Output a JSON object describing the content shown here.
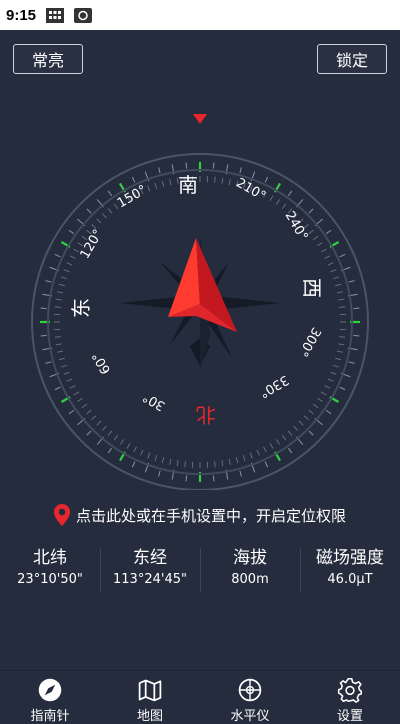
{
  "status_bar": {
    "time": "9:15"
  },
  "header": {
    "left_button": "常亮",
    "right_button": "锁定"
  },
  "compass": {
    "cardinals": {
      "south": "南",
      "west": "西",
      "north": "北",
      "east": "东"
    },
    "degree_labels": [
      "210°",
      "240°",
      "300°",
      "330°",
      "30°",
      "60°",
      "120°",
      "150°"
    ],
    "colors": {
      "needle": "#e8262d",
      "north_label": "#e8262d",
      "tick_accent": "#2fd23c",
      "background": "#252c3d"
    }
  },
  "location": {
    "icon": "map-pin-icon",
    "text": "点击此处或在手机设置中，开启定位权限"
  },
  "stats": [
    {
      "label": "北纬",
      "value": "23°10'50\""
    },
    {
      "label": "东经",
      "value": "113°24'45\""
    },
    {
      "label": "海拔",
      "value": "800m"
    },
    {
      "label": "磁场强度",
      "value": "46.0μT"
    }
  ],
  "bottom_nav": [
    {
      "label": "指南针",
      "icon": "compass-icon"
    },
    {
      "label": "地图",
      "icon": "map-icon"
    },
    {
      "label": "水平仪",
      "icon": "level-icon"
    },
    {
      "label": "设置",
      "icon": "gear-icon"
    }
  ]
}
